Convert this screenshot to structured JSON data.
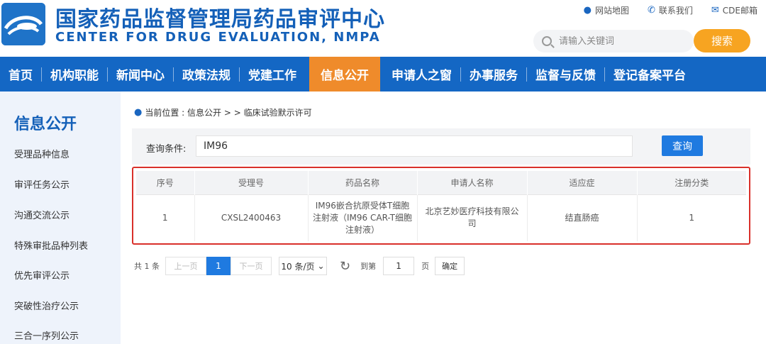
{
  "header": {
    "title_cn": "国家药品监督管理局药品审评中心",
    "title_en": "CENTER FOR DRUG EVALUATION, NMPA",
    "toplinks": [
      {
        "icon": "location-pin-icon",
        "label": "网站地图"
      },
      {
        "icon": "phone-icon",
        "label": "联系我们"
      },
      {
        "icon": "mail-icon",
        "label": "CDE邮箱"
      }
    ],
    "search_placeholder": "请输入关键词",
    "search_button": "搜索",
    "brand_color": "#1460b8",
    "accent_color": "#f7a421"
  },
  "nav": {
    "items": [
      {
        "label": "首页",
        "active": false
      },
      {
        "label": "机构职能",
        "active": false
      },
      {
        "label": "新闻中心",
        "active": false
      },
      {
        "label": "政策法规",
        "active": false
      },
      {
        "label": "党建工作",
        "active": false
      },
      {
        "label": "信息公开",
        "active": true
      },
      {
        "label": "申请人之窗",
        "active": false
      },
      {
        "label": "办事服务",
        "active": false
      },
      {
        "label": "监督与反馈",
        "active": false
      },
      {
        "label": "登记备案平台",
        "active": false
      }
    ],
    "bar_color": "#1467c4",
    "active_color": "#ef8b2b"
  },
  "sidebar": {
    "title": "信息公开",
    "items": [
      "受理品种信息",
      "审评任务公示",
      "沟通交流公示",
      "特殊审批品种列表",
      "优先审评公示",
      "突破性治疗公示",
      "三合一序列公示"
    ]
  },
  "breadcrumb": {
    "text": "当前位置 : 信息公开 > > 临床试验默示许可"
  },
  "query": {
    "label": "查询条件:",
    "value": "IM96",
    "button": "查询"
  },
  "table": {
    "headers": [
      "序号",
      "受理号",
      "药品名称",
      "申请人名称",
      "适应症",
      "注册分类"
    ],
    "rows": [
      [
        "1",
        "CXSL2400463",
        "IM96嵌合抗原受体T细胞注射液（IM96 CAR-T细胞注射液）",
        "北京艺妙医疗科技有限公司",
        "结直肠癌",
        "1"
      ]
    ]
  },
  "pager": {
    "total": "共 1 条",
    "prev": "上一页",
    "current": "1",
    "next": "下一页",
    "page_size": "10 条/页",
    "goto_label": "到第",
    "goto_value": "1",
    "page_unit": "页",
    "confirm": "确定"
  }
}
